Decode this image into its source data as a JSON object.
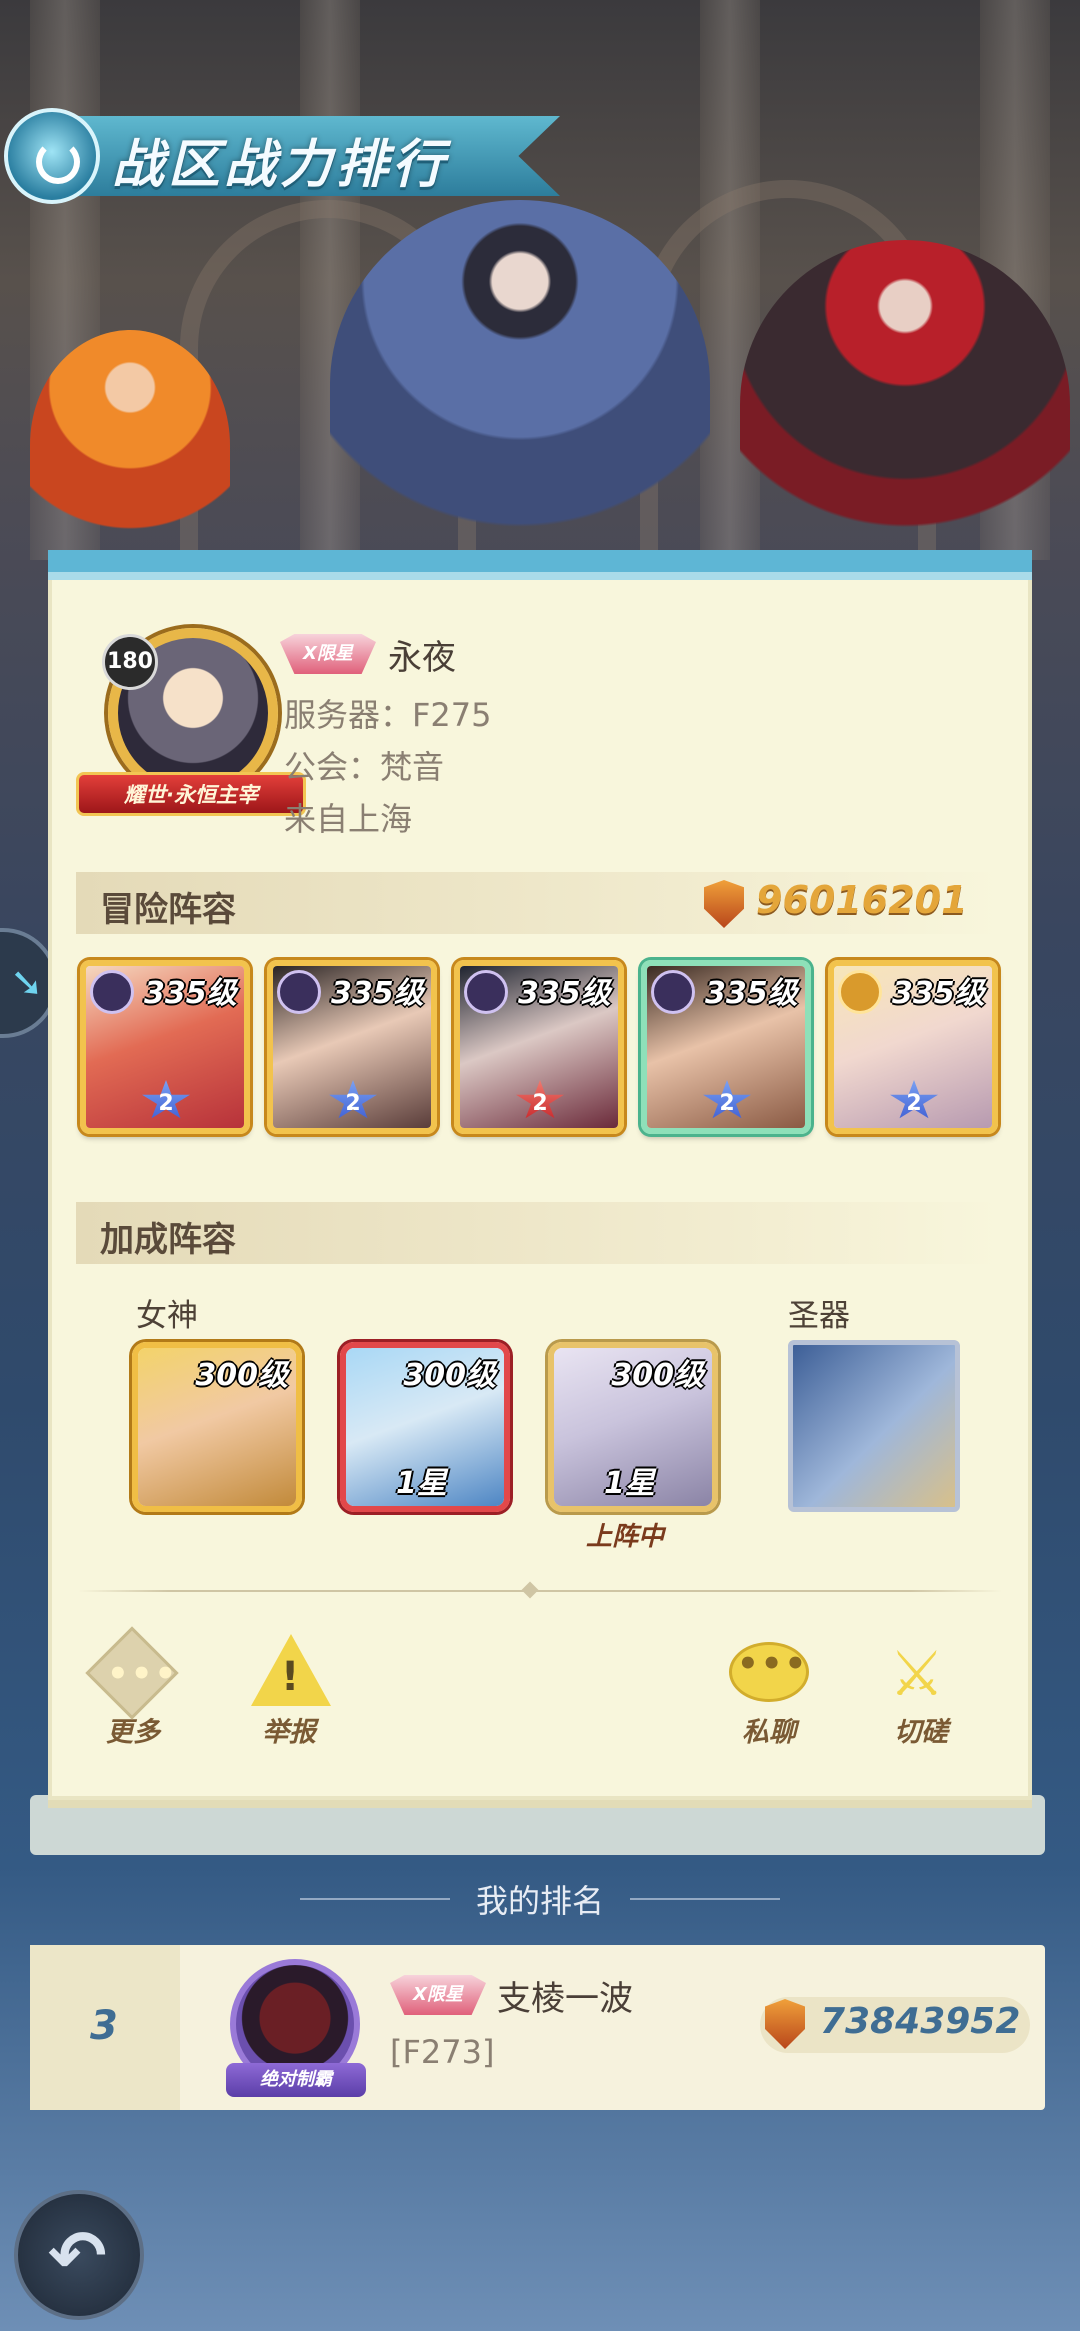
{
  "header": {
    "title": "战区战力排行"
  },
  "profile": {
    "level": "180",
    "frame_title": "耀世·永恒主宰",
    "vip_badge": "X限星",
    "name": "永夜",
    "server": "服务器：F275",
    "guild": "公会：梵音",
    "location": "来自上海"
  },
  "adventure": {
    "title": "冒险阵容",
    "power": "96016201",
    "heroes": [
      {
        "level": "335级",
        "stars": "2",
        "faction": "dark"
      },
      {
        "level": "335级",
        "stars": "2",
        "faction": "dark"
      },
      {
        "level": "335级",
        "stars": "2",
        "faction": "dark"
      },
      {
        "level": "335级",
        "stars": "2",
        "faction": "dark"
      },
      {
        "level": "335级",
        "stars": "2",
        "faction": "light"
      }
    ]
  },
  "bonus": {
    "title": "加成阵容",
    "goddess_label": "女神",
    "artifact_label": "圣器",
    "goddesses": [
      {
        "level": "300级",
        "stars": ""
      },
      {
        "level": "300级",
        "stars": "1星"
      },
      {
        "level": "300级",
        "stars": "1星"
      }
    ],
    "deployed_label": "上阵中"
  },
  "actions": {
    "more": "更多",
    "report": "举报",
    "chat": "私聊",
    "duel": "切磋"
  },
  "my_rank": {
    "title": "我的排名",
    "rank": "3",
    "frame_title": "绝对制霸",
    "vip_badge": "X限星",
    "name": "支棱一波",
    "server": "[F273]",
    "power": "73843952"
  },
  "colors": {
    "banner": "#2d7d9c",
    "card_bg": "#f8f6dc",
    "power_gold": "#e4a63a",
    "my_rank_blue": "#3f6d93"
  }
}
